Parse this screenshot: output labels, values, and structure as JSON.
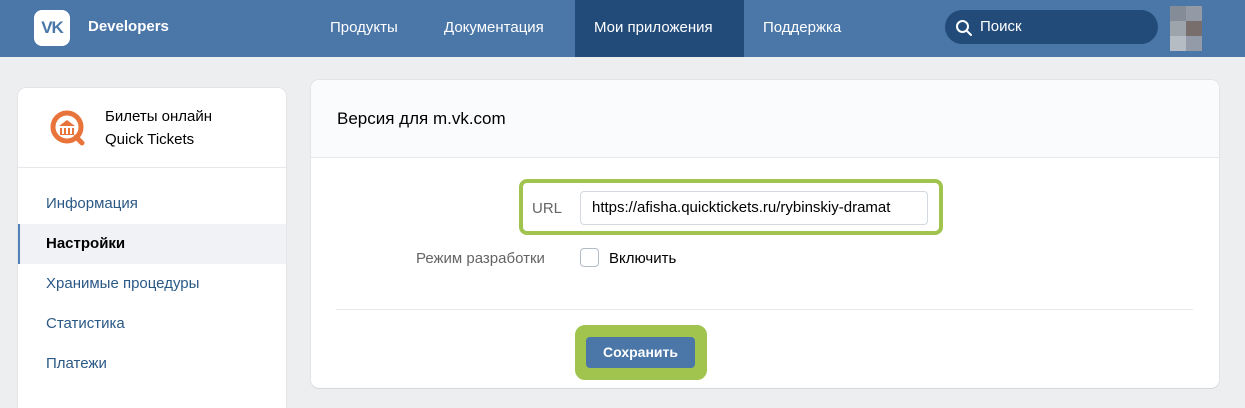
{
  "header": {
    "logo_text": "VK",
    "brand": "Developers",
    "nav": [
      {
        "label": "Продукты"
      },
      {
        "label": "Документация"
      },
      {
        "label": "Мои приложения"
      },
      {
        "label": "Поддержка"
      }
    ],
    "active_nav": "Мои приложения",
    "search_placeholder": "Поиск"
  },
  "app": {
    "title": "Билеты онлайн",
    "subtitle": "Quick Tickets"
  },
  "sidebar": {
    "items": [
      {
        "label": "Информация"
      },
      {
        "label": "Настройки"
      },
      {
        "label": "Хранимые процедуры"
      },
      {
        "label": "Статистика"
      },
      {
        "label": "Платежи"
      }
    ],
    "active": "Настройки"
  },
  "main": {
    "title": "Версия для m.vk.com",
    "url_label": "URL",
    "url_value": "https://afisha.quicktickets.ru/rybinskiy-dramat",
    "dev_mode_label": "Режим разработки",
    "dev_mode_checkbox_label": "Включить",
    "dev_mode_checked": false,
    "save_label": "Сохранить"
  },
  "colors": {
    "header_bg": "#4a76a8",
    "header_active": "#224b7a",
    "highlight": "#a1c44e",
    "link": "#2a5885"
  }
}
